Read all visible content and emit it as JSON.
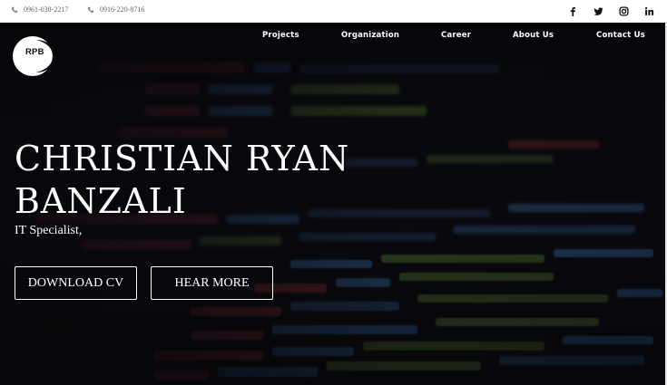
{
  "topbar": {
    "phone1": "0961-038-2217",
    "phone2": "0916-220-8716",
    "phone_icon": "phone-icon",
    "socials": [
      {
        "name": "facebook-icon",
        "glyph": "f"
      },
      {
        "name": "twitter-icon",
        "glyph": "t"
      },
      {
        "name": "instagram-icon",
        "glyph": "ig"
      },
      {
        "name": "linkedin-icon",
        "glyph": "in"
      }
    ]
  },
  "logo": {
    "text": "RPB"
  },
  "nav": {
    "items": [
      "Projects",
      "Organization",
      "Career",
      "About Us",
      "Contact Us"
    ]
  },
  "hero": {
    "name": "CHRISTIAN RYAN BANZALI",
    "role": "IT Specialist,",
    "download_label": "DOWNLOAD CV",
    "hear_more_label": "HEAR MORE"
  },
  "colors": {
    "hero_bg": "#0b0b10",
    "text": "#ffffff",
    "code_red": "#c8463e",
    "code_blue": "#3b6fb0",
    "code_green": "#6a8a3a"
  }
}
